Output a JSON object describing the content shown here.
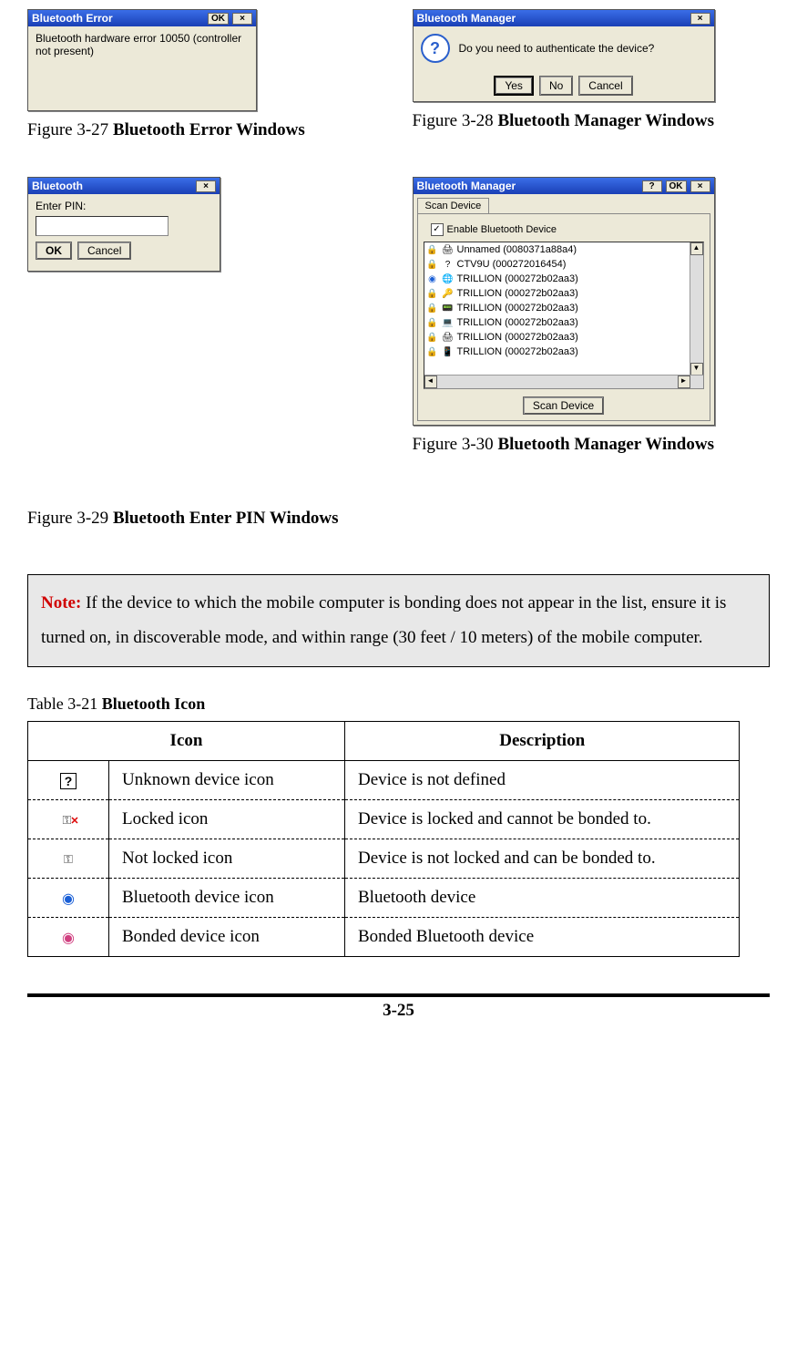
{
  "figures": {
    "f27": {
      "title": "Bluetooth Error",
      "ok": "OK",
      "close": "×",
      "message": "Bluetooth hardware error 10050 (controller not present)",
      "caption_prefix": "Figure 3-27 ",
      "caption_bold": "Bluetooth Error Windows"
    },
    "f28": {
      "title": "Bluetooth Manager",
      "close": "×",
      "message": "Do you need to authenticate the device?",
      "yes": "Yes",
      "no": "No",
      "cancel": "Cancel",
      "caption_prefix": "Figure 3-28 ",
      "caption_bold": "Bluetooth Manager Windows"
    },
    "f29": {
      "title": "Bluetooth",
      "close": "×",
      "label": "Enter PIN:",
      "ok": "OK",
      "cancel": "Cancel",
      "caption_prefix": "Figure 3-29 ",
      "caption_bold": "Bluetooth Enter PIN Windows"
    },
    "f30": {
      "title": "Bluetooth Manager",
      "help": "?",
      "ok": "OK",
      "close": "×",
      "tab": "Scan Device",
      "enable_checkbox": "Enable Bluetooth Device",
      "devices": [
        "Unnamed (0080371a88a4)",
        "CTV9U (000272016454)",
        "TRILLION (000272b02aa3)",
        "TRILLION (000272b02aa3)",
        "TRILLION (000272b02aa3)",
        "TRILLION (000272b02aa3)",
        "TRILLION (000272b02aa3)",
        "TRILLION (000272b02aa3)"
      ],
      "scan_button": "Scan Device",
      "caption_prefix": "Figure 3-30 ",
      "caption_bold": "Bluetooth Manager Windows"
    }
  },
  "note": {
    "label": "Note:",
    "text": " If the device to which the mobile computer is bonding does not appear in the list, ensure it is turned on, in discoverable mode, and within range (30 feet / 10 meters) of the mobile computer."
  },
  "table": {
    "caption_prefix": "Table 3-21 ",
    "caption_bold": "Bluetooth Icon",
    "headers": {
      "icon": "Icon",
      "desc": "Description"
    },
    "rows": [
      {
        "icon_kind": "unknown",
        "name": "Unknown device icon",
        "desc": "Device is not defined"
      },
      {
        "icon_kind": "locked",
        "name": "Locked icon",
        "desc": "Device is locked and cannot be bonded to."
      },
      {
        "icon_kind": "unlocked",
        "name": "Not locked icon",
        "desc": "Device is not locked and can be bonded to."
      },
      {
        "icon_kind": "bt",
        "name": "Bluetooth device icon",
        "desc": "Bluetooth device"
      },
      {
        "icon_kind": "bonded",
        "name": "Bonded device icon",
        "desc": "Bonded Bluetooth device"
      }
    ]
  },
  "page_number": "3-25"
}
